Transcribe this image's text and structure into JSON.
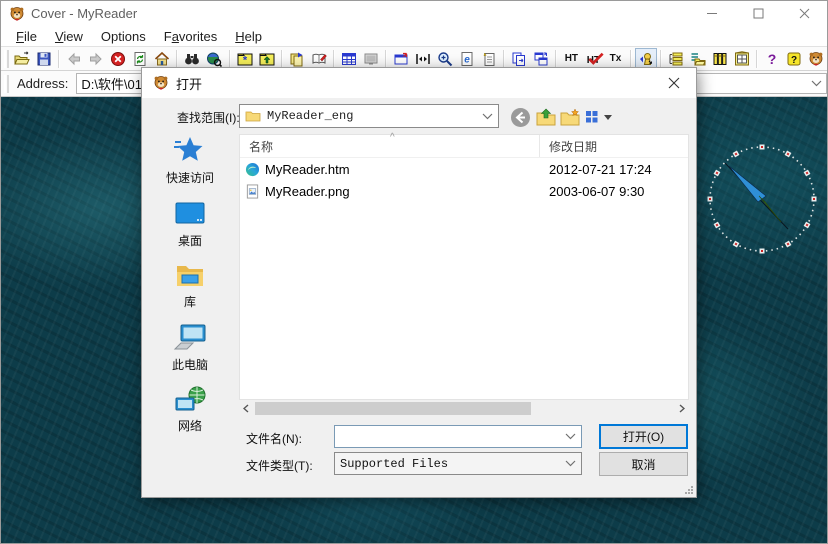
{
  "window": {
    "title": "Cover - MyReader"
  },
  "menu": {
    "items": [
      {
        "pre": "",
        "u": "F",
        "post": "ile"
      },
      {
        "pre": "",
        "u": "V",
        "post": "iew"
      },
      {
        "pre": "Options",
        "u": "",
        "post": ""
      },
      {
        "pre": "F",
        "u": "a",
        "post": "vorites"
      },
      {
        "pre": "",
        "u": "H",
        "post": "elp"
      }
    ]
  },
  "toolbar": {
    "ht_label": "HT",
    "ht_check_label": "HT",
    "tx_label": "Tx"
  },
  "addressbar": {
    "label": "Address:",
    "value": "D:\\软件\\01.3"
  },
  "dialog": {
    "title": "打开",
    "look_in_label": "查找范围(I):",
    "look_in_value": "MyReader_eng",
    "sidebar": {
      "items": [
        {
          "label": "快速访问"
        },
        {
          "label": "桌面"
        },
        {
          "label": "库"
        },
        {
          "label": "此电脑"
        },
        {
          "label": "网络"
        }
      ]
    },
    "list": {
      "sort_caret": "^",
      "columns": [
        {
          "label": "名称"
        },
        {
          "label": "修改日期"
        }
      ],
      "rows": [
        {
          "name": "MyReader.htm",
          "date": "2012-07-21 17:24"
        },
        {
          "name": "MyReader.png",
          "date": "2003-06-07 9:30"
        }
      ]
    },
    "file_name_label": "文件名(N):",
    "file_name_value": "",
    "file_type_label": "文件类型(T):",
    "file_type_value": "Supported Files",
    "open_label": "打开(O)",
    "cancel_label": "取消"
  },
  "colors": {
    "accent_blue": "#0078d7",
    "content_teal": "#0d3c49",
    "clock_red": "#cc2222"
  }
}
